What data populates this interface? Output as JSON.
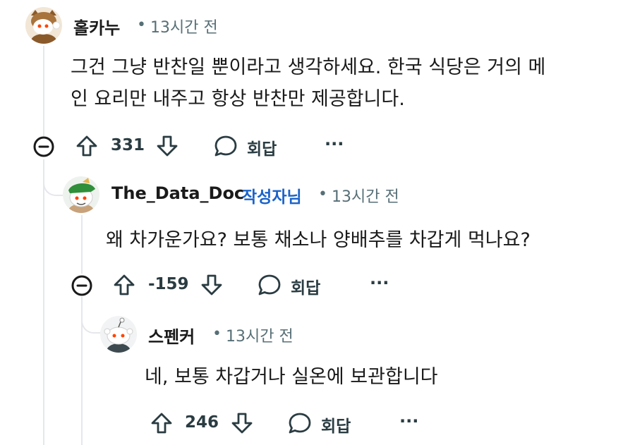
{
  "comments": [
    {
      "username": "홀카누",
      "separator": "•",
      "time": "13시간 전",
      "body_line1": "그건 그냥 반찬일 뿐이라고 생각하세요. 한국 식당은 거의 메",
      "body_line2": "인 요리만 내주고 항상 반찬만 제공합니다.",
      "score": "331",
      "reply_label": "회답",
      "more": "···"
    },
    {
      "username": "The_Data_Doc",
      "op_badge": "작성자님",
      "separator": "•",
      "time": "13시간 전",
      "body_line1": "왜 차가운가요? 보통 채소나 양배추를 차갑게 먹나요?",
      "score": "-159",
      "reply_label": "회답",
      "more": "···"
    },
    {
      "username": "스펜커",
      "separator": "•",
      "time": "13시간 전",
      "body_line1": "네, 보통 차갑거나 실온에 보관합니다",
      "score": "246",
      "reply_label": "회답",
      "more": "···"
    }
  ],
  "icons": {
    "collapse": "minus-circle-icon",
    "upvote": "arrow-up-icon",
    "downvote": "arrow-down-icon",
    "reply": "speech-bubble-icon",
    "more": "ellipsis-icon"
  },
  "colors": {
    "text": "#1a1a1b",
    "meta": "#576f76",
    "op_badge": "#1b63c9",
    "thread_line": "#e5e7eb"
  }
}
